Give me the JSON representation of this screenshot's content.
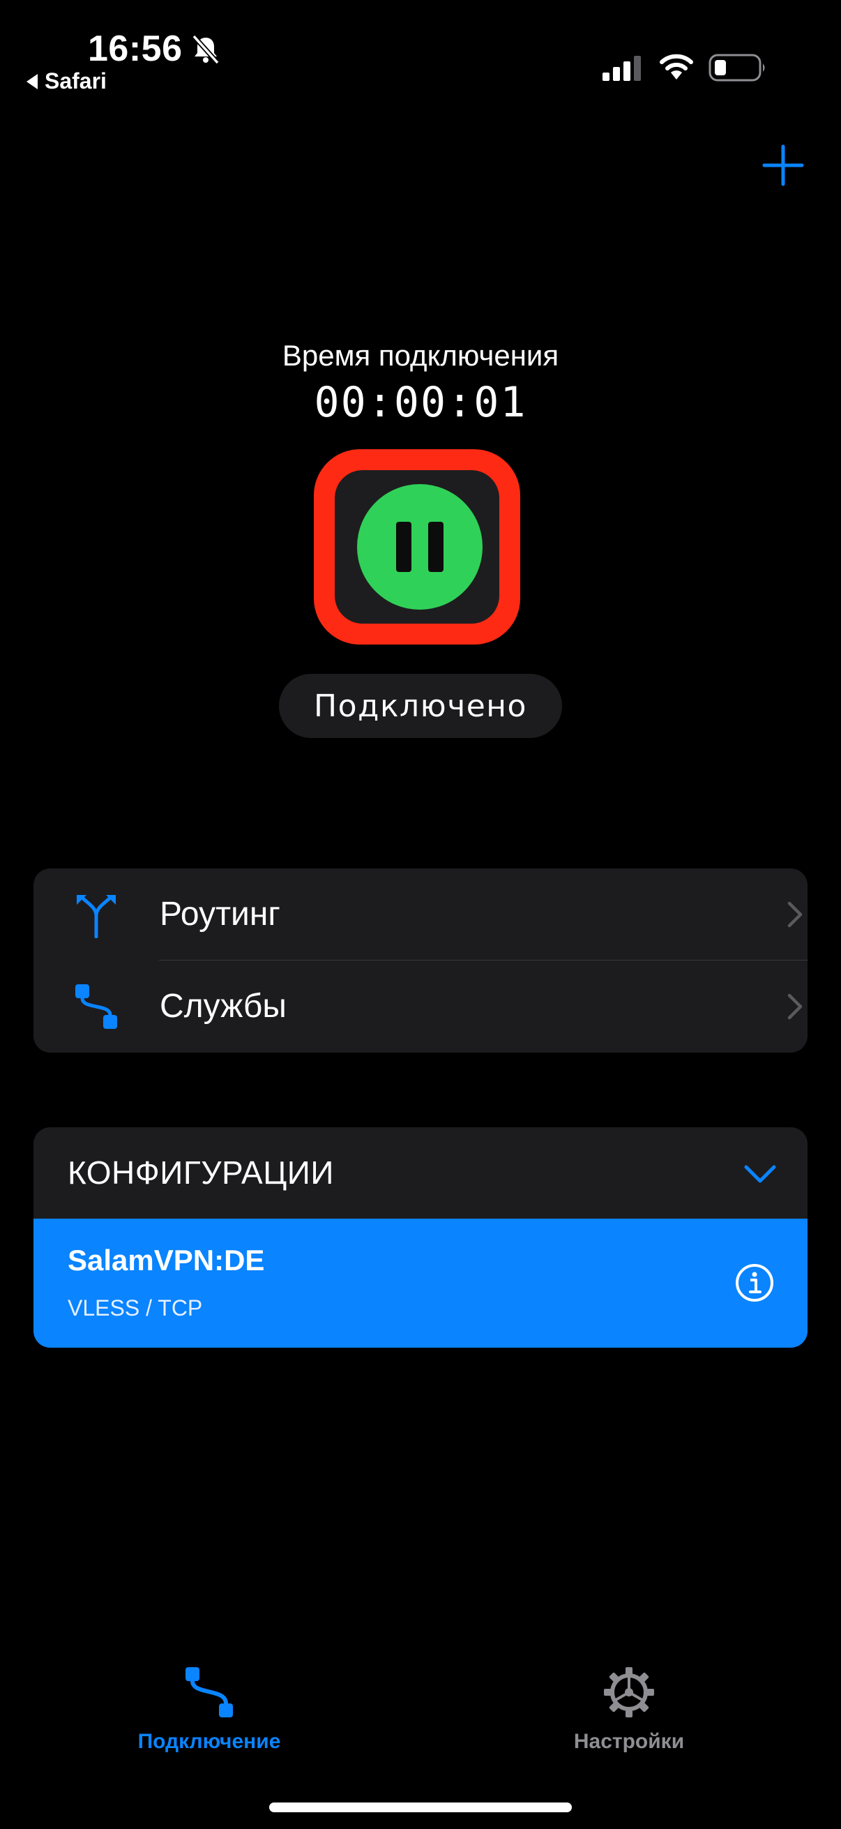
{
  "status_bar": {
    "time": "16:56",
    "back_app": "Safari"
  },
  "connection": {
    "label": "Время подключения",
    "timer": "00:00:01",
    "status": "Подключено"
  },
  "menu": {
    "items": [
      {
        "label": "Роутинг",
        "icon": "routing-icon"
      },
      {
        "label": "Службы",
        "icon": "services-icon"
      }
    ]
  },
  "configurations": {
    "title": "КОНФИГУРАЦИИ",
    "items": [
      {
        "name": "SalamVPN:DE",
        "protocol": "VLESS / TCP",
        "selected": true
      }
    ]
  },
  "tab_bar": {
    "tabs": [
      {
        "label": "Подключение",
        "icon": "connection-icon",
        "active": true
      },
      {
        "label": "Настройки",
        "icon": "gear-icon",
        "active": false
      }
    ]
  },
  "colors": {
    "background": "#000000",
    "card": "#1c1c1e",
    "accent": "#0a84ff",
    "connected": "#30d158",
    "highlight": "#ff2a14",
    "inactive": "#8e8e93"
  }
}
